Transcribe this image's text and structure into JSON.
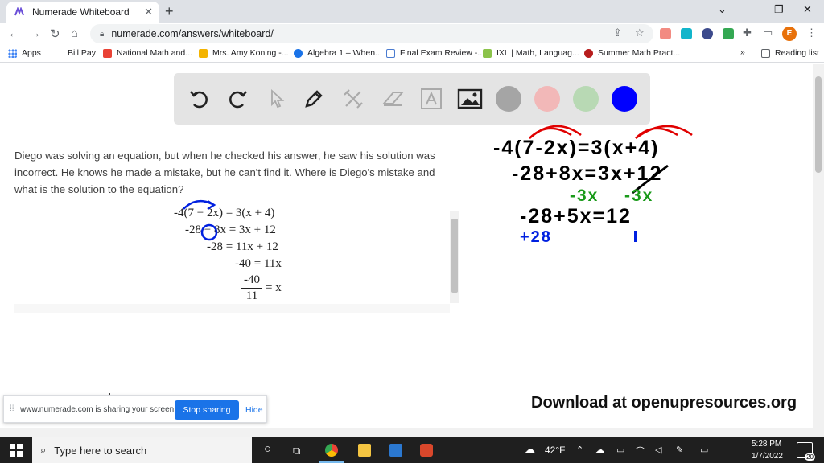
{
  "browser": {
    "tab_title": "Numerade Whiteboard",
    "tab_close": "✕",
    "new_tab": "+",
    "window_controls": [
      "⌄",
      "—",
      "❐",
      "✕"
    ],
    "url": "numerade.com/answers/whiteboard/",
    "avatar_letter": "E",
    "nav": {
      "back": "←",
      "forward": "→",
      "reload": "↻",
      "home": "⌂"
    }
  },
  "bookmarks": {
    "items": [
      {
        "label": "Apps",
        "color": "#4285f4"
      },
      {
        "label": "Bill Pay",
        "color": "#ffffff"
      },
      {
        "label": "National Math and...",
        "color": "#e94235"
      },
      {
        "label": "Mrs. Amy Koning -...",
        "color": "#f4b400"
      },
      {
        "label": "Algebra 1 – When...",
        "color": "#1a73e8"
      },
      {
        "label": "Final Exam Review -...",
        "color": "#4a7bd0"
      },
      {
        "label": "IXL | Math, Languag...",
        "color": "#8bc34a"
      },
      {
        "label": "Summer Math Pract...",
        "color": "#b71c1c"
      }
    ],
    "overflow": "»",
    "reading_list": "Reading list"
  },
  "whiteboard": {
    "colors": [
      "#a5a5a5",
      "#f2b8b8",
      "#b8d9b4",
      "#0000ff"
    ]
  },
  "question": {
    "text": "Diego was solving an equation, but when he checked his answer, he saw his solution was incorrect. He knows he made a mistake, but he can't find it. Where is Diego's mistake and what is the solution to the equation?",
    "steps": [
      "-4(7 − 2x) = 3(x + 4)",
      "-28 − 8x = 3x + 12",
      "-28 = 11x + 12",
      "-40 = 11x",
      "= x"
    ],
    "fraction_num": "-40",
    "fraction_den": "11"
  },
  "handwriting": {
    "line1": "-4(7-2x)=3(x+4)",
    "line2": "-28+8x=3x+12",
    "line3_left": "-3x",
    "line3_right": "-3x",
    "line4": "-28+5x=12",
    "line5": "+28"
  },
  "watermark": "Download at openupresources.org",
  "sharebar": {
    "message": "www.numerade.com is sharing your screen.",
    "stop_label": "Stop sharing",
    "hide_label": "Hide"
  },
  "taskbar": {
    "search_placeholder": "Type here to search",
    "weather": "42°F",
    "time": "5:28 PM",
    "date": "1/7/2022",
    "notifications": "20"
  }
}
